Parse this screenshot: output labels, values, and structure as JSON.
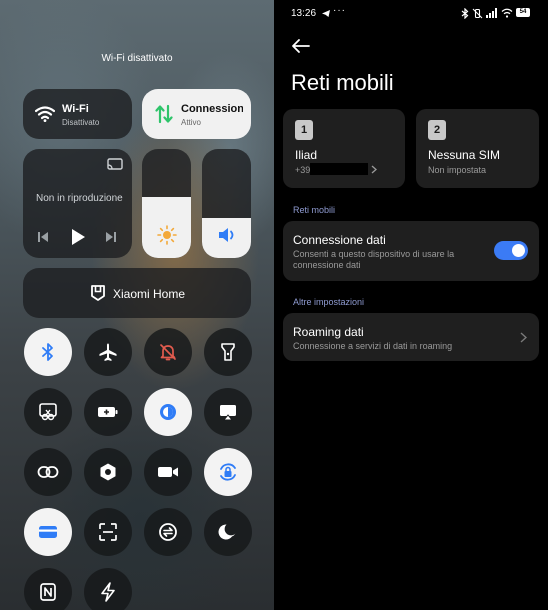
{
  "control_center": {
    "wifi_status_banner": "Wi-Fi disattivato",
    "wifi_tile": {
      "title": "Wi-Fi",
      "subtitle": "Disattivato"
    },
    "data_tile": {
      "title": "Connessione dati",
      "subtitle": "Attivo"
    },
    "media": {
      "status": "Non in riproduzione"
    },
    "brightness_level": 0.56,
    "volume_level": 0.37,
    "home_tile": {
      "label": "Xiaomi Home"
    },
    "toggles": [
      {
        "icon": "bluetooth-icon",
        "active": true
      },
      {
        "icon": "airplane-icon",
        "active": false
      },
      {
        "icon": "bell-muted-icon",
        "active": false
      },
      {
        "icon": "flashlight-icon",
        "active": false
      },
      {
        "icon": "screenshot-icon",
        "active": false
      },
      {
        "icon": "battery-saver-icon",
        "active": false
      },
      {
        "icon": "reading-mode-icon",
        "active": true
      },
      {
        "icon": "cast-screen-icon",
        "active": false
      },
      {
        "icon": "link-icon",
        "active": false
      },
      {
        "icon": "settings-hex-icon",
        "active": false
      },
      {
        "icon": "video-camera-icon",
        "active": false
      },
      {
        "icon": "rotation-lock-icon",
        "active": true
      },
      {
        "icon": "card-icon",
        "active": true
      },
      {
        "icon": "scanner-icon",
        "active": false
      },
      {
        "icon": "sync-icon",
        "active": false
      },
      {
        "icon": "moon-icon",
        "active": false
      },
      {
        "icon": "nfc-icon",
        "active": false
      },
      {
        "icon": "lightning-icon",
        "active": false
      }
    ],
    "colors": {
      "accent_green": "#2ec46a",
      "accent_blue": "#2f7cf6",
      "bell_red": "#e25b4e",
      "sun_orange": "#f3a93a"
    }
  },
  "settings": {
    "status_bar": {
      "time": "13:26",
      "battery": "54"
    },
    "title": "Reti mobili",
    "sim_cards": [
      {
        "slot": "1",
        "name": "Iliad",
        "number": "+39"
      },
      {
        "slot": "2",
        "name": "Nessuna SIM",
        "status": "Non impostata"
      }
    ],
    "section_mobile": "Reti mobili",
    "data_connection": {
      "title": "Connessione dati",
      "desc": "Consenti a questo dispositivo di usare la connessione dati",
      "enabled": true
    },
    "section_other": "Altre impostazioni",
    "roaming": {
      "title": "Roaming dati",
      "desc": "Connessione a servizi di dati in roaming"
    },
    "colors": {
      "toggle_on": "#3b7bf5",
      "section_label": "#8f9bd1"
    }
  }
}
